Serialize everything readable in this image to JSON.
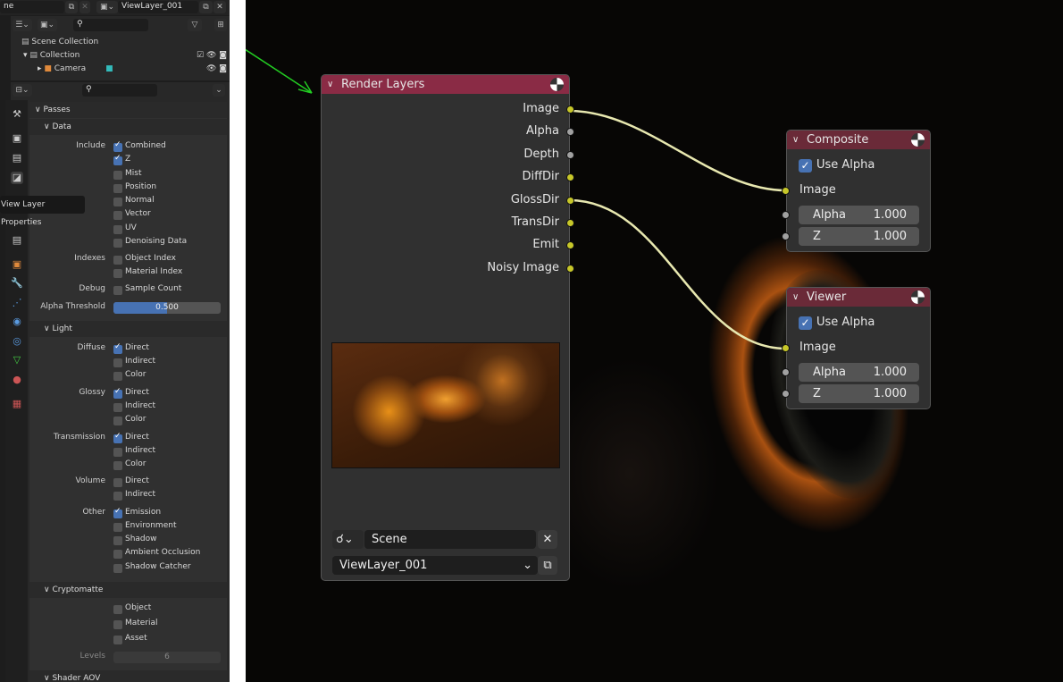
{
  "topbar": {
    "scene_field": "ne",
    "view_layer_field": "ViewLayer_001"
  },
  "outliner": {
    "items": [
      {
        "label": "Scene Collection"
      },
      {
        "label": "Collection"
      },
      {
        "label": "Camera"
      }
    ]
  },
  "tooltip": "View Layer Properties",
  "properties": {
    "passes": "Passes",
    "data": "Data",
    "rows": [
      {
        "group": "Include",
        "label": "Combined",
        "checked": true
      },
      {
        "label": "Z",
        "checked": true
      },
      {
        "label": "Mist",
        "checked": false
      },
      {
        "label": "Position",
        "checked": false
      },
      {
        "label": "Normal",
        "checked": false
      },
      {
        "label": "Vector",
        "checked": false
      },
      {
        "label": "UV",
        "checked": false
      },
      {
        "label": "Denoising Data",
        "checked": false
      },
      {
        "group": "Indexes",
        "label": "Object Index",
        "checked": false
      },
      {
        "label": "Material Index",
        "checked": false
      },
      {
        "group": "Debug",
        "label": "Sample Count",
        "checked": false
      }
    ],
    "alpha_threshold": {
      "label": "Alpha Threshold",
      "value": "0.500",
      "fraction": 0.5
    },
    "light": "Light",
    "light_rows": [
      {
        "group": "Diffuse",
        "label": "Direct",
        "checked": true
      },
      {
        "label": "Indirect",
        "checked": false
      },
      {
        "label": "Color",
        "checked": false
      },
      {
        "group": "Glossy",
        "label": "Direct",
        "checked": true
      },
      {
        "label": "Indirect",
        "checked": false
      },
      {
        "label": "Color",
        "checked": false
      },
      {
        "group": "Transmission",
        "label": "Direct",
        "checked": true
      },
      {
        "label": "Indirect",
        "checked": false
      },
      {
        "label": "Color",
        "checked": false
      },
      {
        "group": "Volume",
        "label": "Direct",
        "checked": false
      },
      {
        "label": "Indirect",
        "checked": false
      },
      {
        "group": "Other",
        "label": "Emission",
        "checked": true
      },
      {
        "label": "Environment",
        "checked": false
      },
      {
        "label": "Shadow",
        "checked": false
      },
      {
        "label": "Ambient Occlusion",
        "checked": false
      },
      {
        "label": "Shadow Catcher",
        "checked": false
      }
    ],
    "cryptomatte": "Cryptomatte",
    "crypto_rows": [
      {
        "label": "Object",
        "checked": false
      },
      {
        "label": "Material",
        "checked": false
      },
      {
        "label": "Asset",
        "checked": false
      }
    ],
    "levels": {
      "label": "Levels",
      "value": "6"
    },
    "shader_aov": "Shader AOV"
  },
  "nodes": {
    "render_layers": {
      "title": "Render Layers",
      "header_color": "#8a2b45",
      "outputs": [
        "Image",
        "Alpha",
        "Depth",
        "DiffDir",
        "GlossDir",
        "TransDir",
        "Emit",
        "Noisy Image"
      ],
      "scene": "Scene",
      "view_layer": "ViewLayer_001"
    },
    "composite": {
      "title": "Composite",
      "header_color": "#6a2a38",
      "use_alpha": "Use Alpha",
      "input": "Image",
      "alpha_label": "Alpha",
      "alpha_value": "1.000",
      "z_label": "Z",
      "z_value": "1.000"
    },
    "viewer": {
      "title": "Viewer",
      "header_color": "#6a2a38",
      "use_alpha": "Use Alpha",
      "input": "Image",
      "alpha_label": "Alpha",
      "alpha_value": "1.000",
      "z_label": "Z",
      "z_value": "1.000"
    }
  },
  "colors": {
    "accent": "#4772b3",
    "socket_color": "#c7c729",
    "link_color": "#e8e8b0",
    "annotation_arrow": "#22cc22"
  }
}
